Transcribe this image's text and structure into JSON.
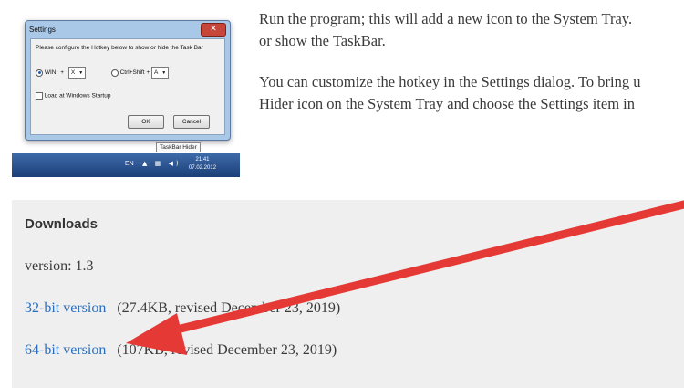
{
  "screenshot": {
    "dialog": {
      "title": "Settings",
      "close_glyph": "✕",
      "instruction": "Please configure the Hotkey below to show or hide the Task Bar",
      "radio_win": "WIN",
      "plus1": "+",
      "combo1": "X",
      "radio_ctrlshift": "Ctrl+Shift +",
      "combo2": "A",
      "checkbox_label": "Load at Windows Startup",
      "ok": "OK",
      "cancel": "Cancel"
    },
    "tooltip": "TaskBar Hider",
    "taskbar": {
      "lang": "EN",
      "tray": "▲ ▦ ◀)",
      "time": "21:41",
      "date": "07.02.2012"
    }
  },
  "text": {
    "line1": "Run the program; this will add a new icon to the System Tray.",
    "line2": "or show the TaskBar.",
    "line3": "You can customize the hotkey in the Settings dialog. To bring u",
    "line4": "Hider icon on the System Tray and choose the Settings item in"
  },
  "downloads": {
    "heading": "Downloads",
    "version": "version: 1.3",
    "link32": "32-bit version",
    "info32": "(27.4KB, revised December 23, 2019)",
    "link64": "64-bit version",
    "info64": "(107KB, revised December 23, 2019)"
  },
  "colors": {
    "arrow": "#e53935",
    "link": "#2a6ebb",
    "panel": "#efefef"
  }
}
